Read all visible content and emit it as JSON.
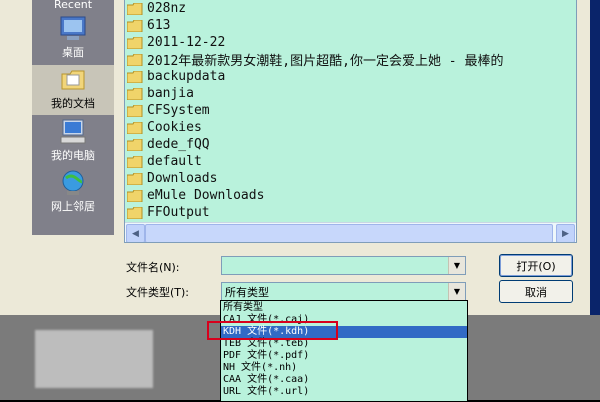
{
  "places": [
    {
      "label": "Recent",
      "icon": "recent-icon"
    },
    {
      "label": "桌面",
      "icon": "desktop-icon"
    },
    {
      "label": "我的文档",
      "icon": "my-documents-icon"
    },
    {
      "label": "我的电脑",
      "icon": "my-computer-icon"
    },
    {
      "label": "网上邻居",
      "icon": "network-places-icon"
    }
  ],
  "files": [
    "028nz",
    "613",
    "2011-12-22",
    "2012年最新款男女潮鞋,图片超酷,你一定会爱上她 - 最棒的",
    "backupdata",
    "banjia",
    "CFSystem",
    "Cookies",
    "dede_fQQ",
    "default",
    "Downloads",
    "eMule Downloads",
    "FFOutput"
  ],
  "filename": {
    "label": "文件名(N):",
    "value": ""
  },
  "filetype": {
    "label": "文件类型(T):",
    "value": "所有类型"
  },
  "buttons": {
    "open": "打开(O)",
    "cancel": "取消"
  },
  "filetype_options": [
    "所有类型",
    "CAJ 文件(*.caj)",
    "KDH 文件(*.kdh)",
    "TEB 文件(*.teb)",
    "PDF 文件(*.pdf)",
    "NH 文件(*.nh)",
    "CAA 文件(*.caa)",
    "URL 文件(*.url)"
  ],
  "selected_option": "KDH 文件(*.kdh)",
  "colors": {
    "list_bg": "#b9f2dc",
    "selection": "#316ac5",
    "annotation": "#d8001c"
  }
}
